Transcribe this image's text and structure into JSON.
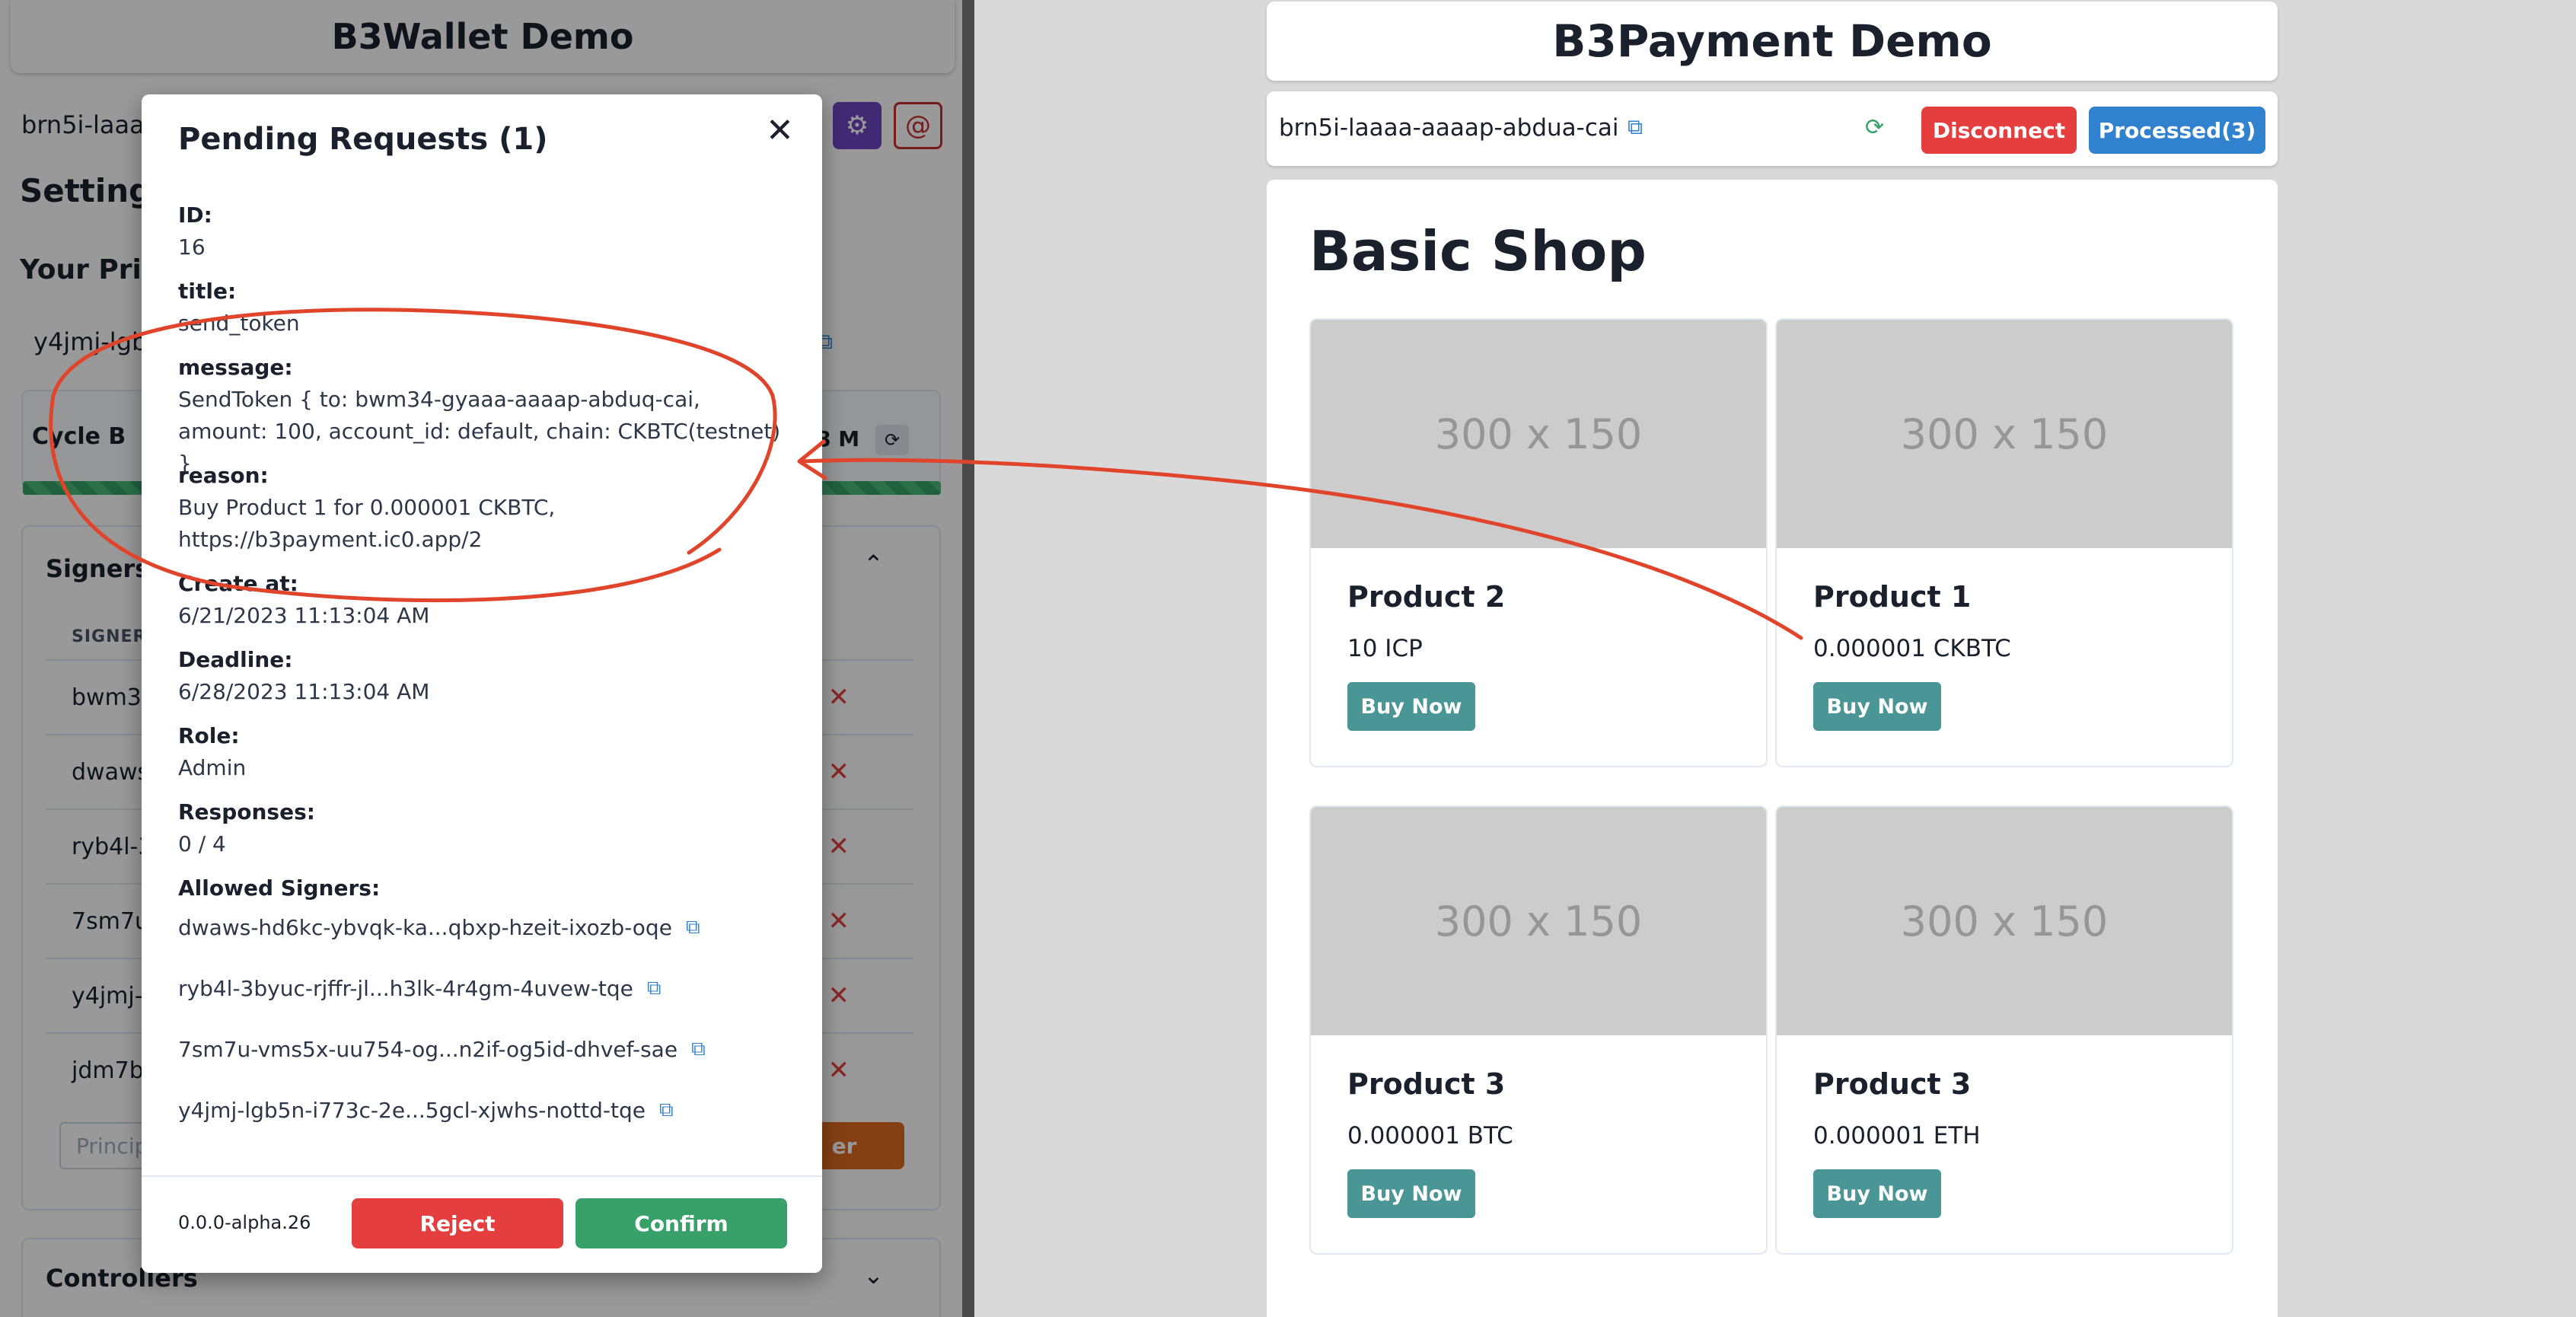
{
  "wallet": {
    "title": "B3Wallet Demo",
    "principal_short": "brn5i-laaa",
    "settings_title": "Settings",
    "your_principal_title": "Your Pri",
    "principal_value": "y4jmj-lgb",
    "cycle_label": "Cycle B",
    "cycle_value": "8 M",
    "signers_title": "Signers",
    "signers_column": "SIGNER",
    "signers": [
      {
        "name": "bwm34"
      },
      {
        "name": "dwaws"
      },
      {
        "name": "ryb4l-3"
      },
      {
        "name": "7sm7u"
      },
      {
        "name": "y4jmj-l"
      },
      {
        "name": "jdm7b-"
      }
    ],
    "principal_input_placeholder": "Princip",
    "add_signer_label": "er",
    "controllers_title": "Controllers",
    "icons": {
      "settings": "gear-icon",
      "at": "at-icon",
      "copy": "copy-icon",
      "refresh": "refresh-icon",
      "delete": "close-icon",
      "chevron": "chevron-icon"
    }
  },
  "modal": {
    "title": "Pending Requests (1)",
    "fields": {
      "id_label": "ID:",
      "id_value": "16",
      "title_label": "title:",
      "title_value": "send_token",
      "message_label": "message:",
      "message_value": "SendToken { to: bwm34-gyaaa-aaaap-abduq-cai, amount: 100, account_id: default, chain: CKBTC(testnet) }",
      "reason_label": "reason:",
      "reason_value": "Buy Product 1 for 0.000001 CKBTC, https://b3payment.ic0.app/2",
      "created_label": "Create at:",
      "created_value": "6/21/2023 11:13:04 AM",
      "deadline_label": "Deadline:",
      "deadline_value": "6/28/2023 11:13:04 AM",
      "role_label": "Role:",
      "role_value": "Admin",
      "responses_label": "Responses:",
      "responses_value": "0 / 4",
      "allowed_label": "Allowed Signers:"
    },
    "allowed_signers": [
      "dwaws-hd6kc-ybvqk-ka...qbxp-hzeit-ixozb-oqe",
      "ryb4l-3byuc-rjffr-jl...h3lk-4r4gm-4uvew-tqe",
      "7sm7u-vms5x-uu754-og...n2if-og5id-dhvef-sae",
      "y4jmj-lgb5n-i773c-2e...5gcl-xjwhs-nottd-tqe"
    ],
    "version": "0.0.0-alpha.26",
    "reject_label": "Reject",
    "confirm_label": "Confirm"
  },
  "payment": {
    "title": "B3Payment Demo",
    "principal": "brn5i-laaaa-aaaap-abdua-cai",
    "disconnect_label": "Disconnect",
    "processed_label": "Processed(3)",
    "shop_title": "Basic Shop",
    "image_placeholder": "300 x 150",
    "buy_label": "Buy Now",
    "products": [
      {
        "name": "Product 2",
        "price": "10 ICP"
      },
      {
        "name": "Product 1",
        "price": "0.000001 CKBTC"
      },
      {
        "name": "Product 3",
        "price": "0.000001 BTC"
      },
      {
        "name": "Product 3",
        "price": "0.000001 ETH"
      }
    ]
  },
  "colors": {
    "accent_purple": "#6b46c1",
    "danger": "#e53e3e",
    "success": "#38a169",
    "primary": "#3182ce",
    "teal": "#4a9696",
    "annotation": "#e0452b"
  }
}
